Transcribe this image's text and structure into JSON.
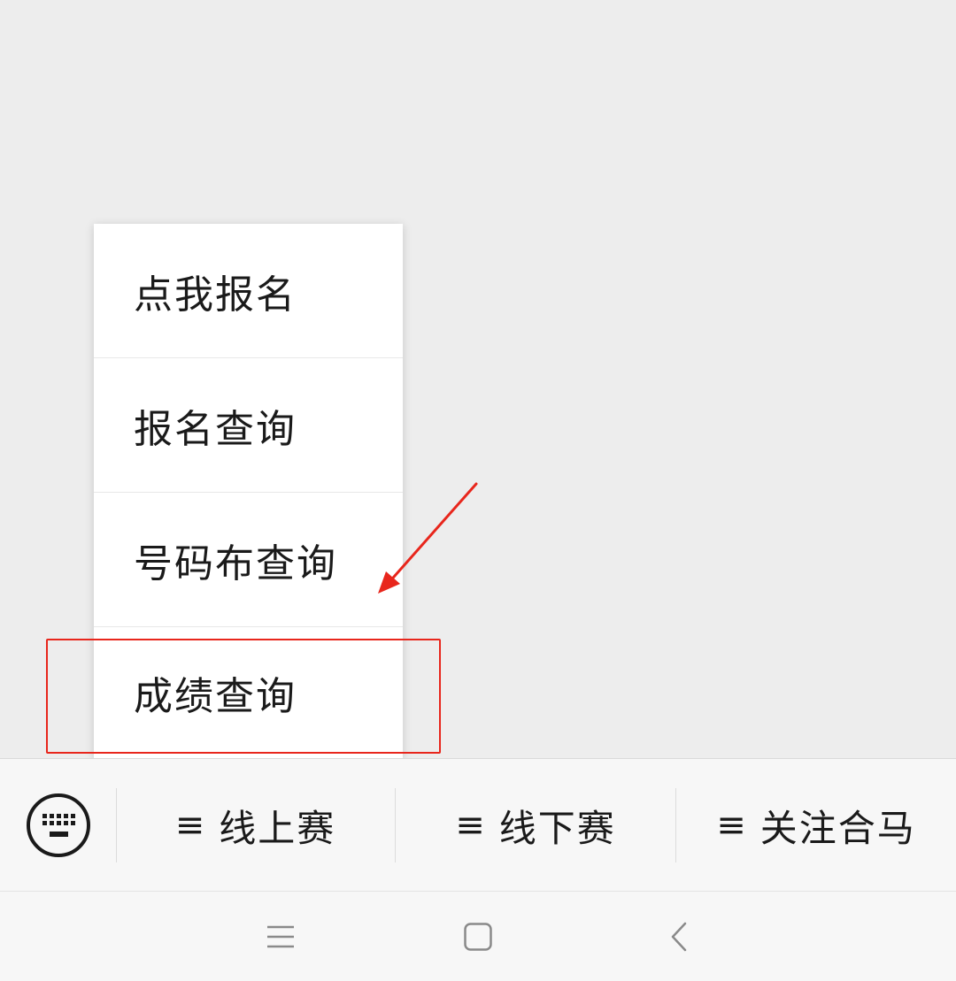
{
  "submenu": {
    "items": [
      {
        "label": "点我报名"
      },
      {
        "label": "报名查询"
      },
      {
        "label": "号码布查询"
      },
      {
        "label": "成绩查询"
      }
    ]
  },
  "menu_bar": {
    "keyboard_icon": "keyboard-icon",
    "menus": [
      {
        "label": "线上赛",
        "icon": "hamburger-icon",
        "glyph": "≡"
      },
      {
        "label": "线下赛",
        "icon": "hamburger-icon",
        "glyph": "≡"
      },
      {
        "label": "关注合马",
        "icon": "hamburger-icon",
        "glyph": "≡"
      }
    ]
  },
  "nav_bar": {
    "buttons": [
      "menu-icon",
      "home-icon",
      "back-icon"
    ]
  },
  "annotation": {
    "color": "#e8261c"
  }
}
